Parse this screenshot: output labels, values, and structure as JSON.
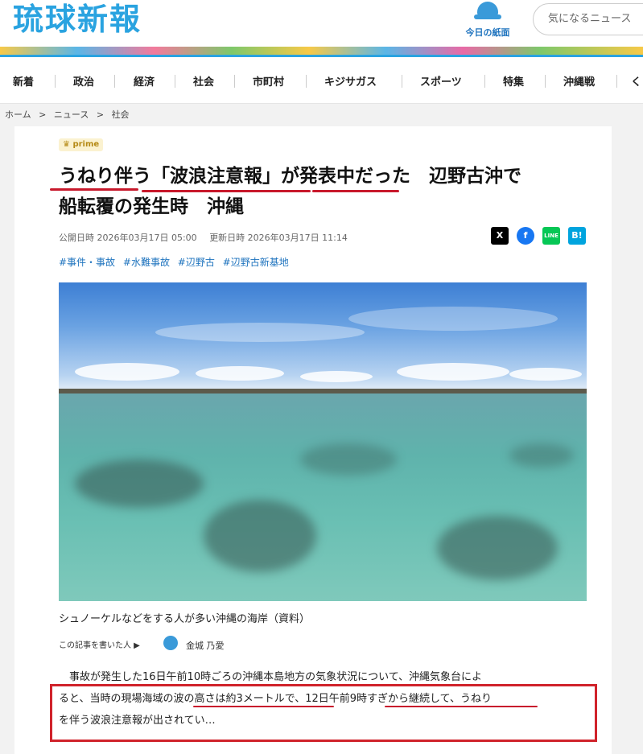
{
  "header": {
    "logo": "琉球新報",
    "paper_label": "今日の紙面",
    "search_placeholder": "気になるニュース"
  },
  "nav": {
    "items": [
      "新着",
      "政治",
      "経済",
      "社会",
      "市町村",
      "キジサガス",
      "スポーツ",
      "特集",
      "沖縄戦",
      "く"
    ]
  },
  "breadcrumb": [
    "ホーム",
    ">",
    "ニュース",
    ">",
    "社会"
  ],
  "article": {
    "badge": "♛ prime",
    "title_line1": "うねり伴う「波浪注意報」が発表中だった　辺野古沖で",
    "title_line2": "船転覆の発生時　沖縄",
    "published": "公開日時 2026年03月17日 05:00",
    "updated": "更新日時 2026年03月17日 11:14",
    "tags": [
      "#事件・事故",
      "#水難事故",
      "#辺野古",
      "#辺野古新基地"
    ],
    "caption": "シュノーケルなどをする人が多い沖縄の海岸（資料）",
    "author_label": "この記事を書いた人 ▶",
    "author_name": "金城 乃愛",
    "body_line1": "　事故が発生した16日午前10時ごろの沖縄本島地方の気象状況について、沖縄気象台によ",
    "body_line2": "ると、当時の現場海域の波の高さは約3メートルで、12日午前9時すぎから継続して、うねり",
    "body_line3": "を伴う波浪注意報が出されてい…"
  },
  "share": {
    "x": "X",
    "facebook": "f",
    "line": "LINE",
    "hatena": "B!"
  },
  "colors": {
    "brand": "#2aa3e0",
    "highlight": "#d0232b",
    "tag": "#1e73be"
  }
}
